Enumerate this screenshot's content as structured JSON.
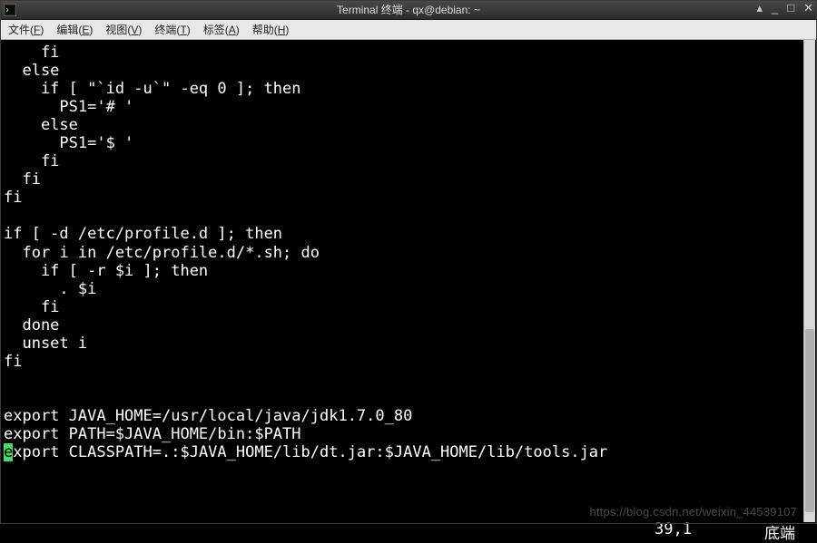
{
  "window": {
    "title": "Terminal 终端 - qx@debian: ~"
  },
  "menubar": {
    "items": [
      {
        "label": "文件",
        "hotkey": "F"
      },
      {
        "label": "编辑",
        "hotkey": "E"
      },
      {
        "label": "视图",
        "hotkey": "V"
      },
      {
        "label": "终端",
        "hotkey": "T"
      },
      {
        "label": "标签",
        "hotkey": "A"
      },
      {
        "label": "帮助",
        "hotkey": "H"
      }
    ]
  },
  "terminal": {
    "lines": [
      "    fi",
      "  else",
      "    if [ \"`id -u`\" -eq 0 ]; then",
      "      PS1='# '",
      "    else",
      "      PS1='$ '",
      "    fi",
      "  fi",
      "fi",
      "",
      "if [ -d /etc/profile.d ]; then",
      "  for i in /etc/profile.d/*.sh; do",
      "    if [ -r $i ]; then",
      "      . $i",
      "    fi",
      "  done",
      "  unset i",
      "fi",
      "",
      "",
      "export JAVA_HOME=/usr/local/java/jdk1.7.0_80",
      "export PATH=$JAVA_HOME/bin:$PATH"
    ],
    "cursor_line_prefix": "e",
    "cursor_line_rest": "xport CLASSPATH=.:$JAVA_HOME/lib/dt.jar:$JAVA_HOME/lib/tools.jar",
    "status_position": "39,1",
    "status_mode": "底端"
  },
  "watermark": "https://blog.csdn.net/weixin_44539107"
}
